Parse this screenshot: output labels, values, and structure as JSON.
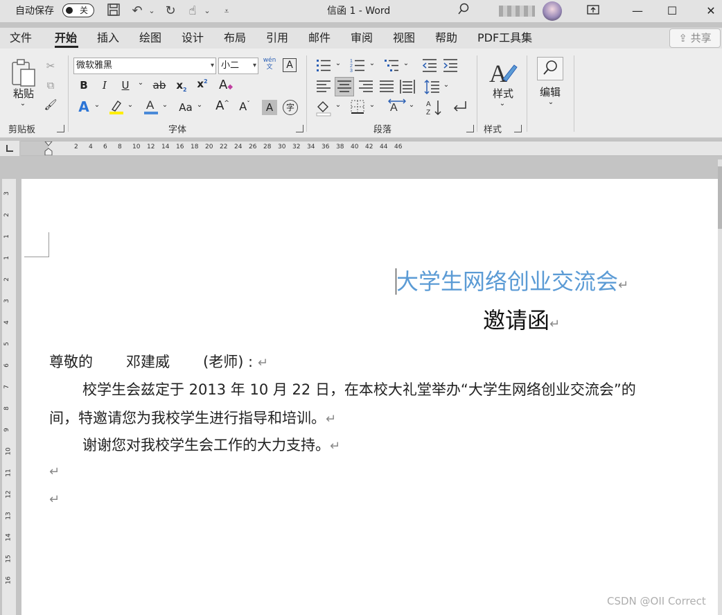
{
  "titlebar": {
    "autosave_label": "自动保存",
    "autosave_state": "关",
    "doc_title": "信函 1  -  Word"
  },
  "menubar": {
    "tabs": [
      "文件",
      "开始",
      "插入",
      "绘图",
      "设计",
      "布局",
      "引用",
      "邮件",
      "审阅",
      "视图",
      "帮助",
      "PDF工具集"
    ],
    "active_tab": "开始",
    "share_label": "共享"
  },
  "ribbon": {
    "clipboard": {
      "paste_label": "粘贴",
      "group_label": "剪贴板"
    },
    "font": {
      "font_name": "微软雅黑",
      "font_size": "小二",
      "group_label": "字体",
      "wen_label": "wén",
      "wen_char": "文",
      "bold": "B",
      "italic": "I",
      "underline": "U",
      "strike": "ab",
      "sub": "x",
      "sup": "x",
      "case": "Aa",
      "grow": "A",
      "shrink": "A",
      "char_shade": "A",
      "encircle": "字"
    },
    "paragraph": {
      "group_label": "段落"
    },
    "styles": {
      "label": "样式",
      "group_label": "样式"
    },
    "editing": {
      "label": "编辑"
    }
  },
  "ruler_h": [
    "2",
    "4",
    "6",
    "8",
    "10",
    "12",
    "14",
    "16",
    "18",
    "20",
    "22",
    "24",
    "26",
    "28",
    "30",
    "32",
    "34",
    "36",
    "38",
    "40",
    "42",
    "44",
    "46"
  ],
  "ruler_v": [
    "3",
    "2",
    "1",
    "1",
    "2",
    "3",
    "4",
    "5",
    "6",
    "7",
    "8",
    "9",
    "10",
    "11",
    "12",
    "13",
    "14",
    "15",
    "16"
  ],
  "document": {
    "title": "大学生网络创业交流会",
    "subtitle": "邀请函",
    "salutation_prefix": "尊敬的",
    "recipient": "邓建威",
    "role": "(老师) :",
    "body_line1": "校学生会兹定于 2013 年 10 月 22 日，在本校大礼堂举办“大学生网络创业交流会”的",
    "body_line2": "间，特邀请您为我校学生进行指导和培训。",
    "body_line3": "谢谢您对我校学生会工作的大力支持。",
    "para_mark": "↵"
  },
  "watermark": "CSDN @OII Correct"
}
